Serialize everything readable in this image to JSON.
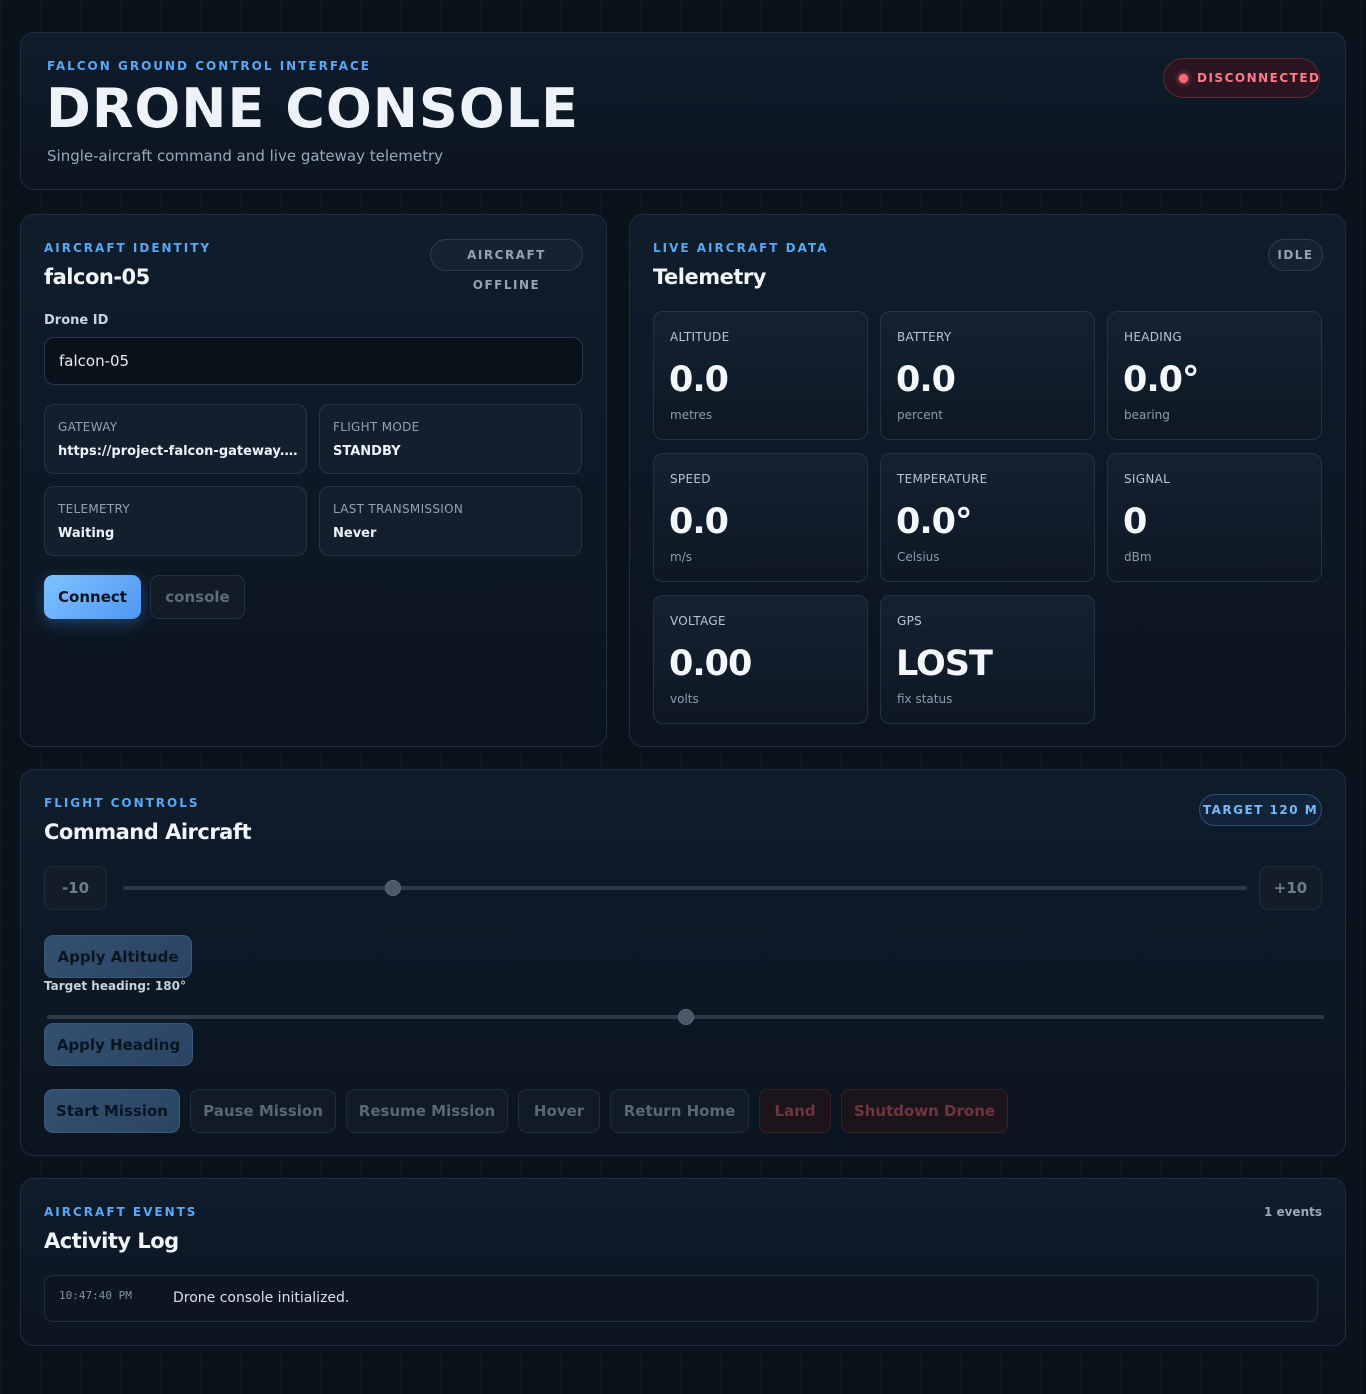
{
  "header": {
    "eyebrow": "FALCON GROUND CONTROL INTERFACE",
    "title": "DRONE CONSOLE",
    "subtitle": "Single-aircraft command and live gateway telemetry",
    "connection_status": "DISCONNECTED"
  },
  "identity": {
    "eyebrow": "AIRCRAFT IDENTITY",
    "title": "falcon-05",
    "status_pill": "AIRCRAFT OFFLINE",
    "drone_id_label": "Drone ID",
    "drone_id_value": "falcon-05",
    "info": [
      {
        "label": "GATEWAY",
        "value": "https://project-falcon-gateway.o..."
      },
      {
        "label": "FLIGHT MODE",
        "value": "STANDBY"
      },
      {
        "label": "TELEMETRY",
        "value": "Waiting"
      },
      {
        "label": "LAST TRANSMISSION",
        "value": "Never"
      }
    ],
    "connect_label": "Connect",
    "console_label": "console"
  },
  "telemetry": {
    "eyebrow": "LIVE AIRCRAFT DATA",
    "title": "Telemetry",
    "status_pill": "IDLE",
    "metrics": [
      {
        "label": "ALTITUDE",
        "value": "0.0",
        "unit": "metres"
      },
      {
        "label": "BATTERY",
        "value": "0.0",
        "unit": "percent"
      },
      {
        "label": "HEADING",
        "value": "0.0°",
        "unit": "bearing"
      },
      {
        "label": "SPEED",
        "value": "0.0",
        "unit": "m/s"
      },
      {
        "label": "TEMPERATURE",
        "value": "0.0°",
        "unit": "Celsius"
      },
      {
        "label": "SIGNAL",
        "value": "0",
        "unit": "dBm"
      },
      {
        "label": "VOLTAGE",
        "value": "0.00",
        "unit": "volts"
      },
      {
        "label": "GPS",
        "value": "LOST",
        "unit": "fix status"
      }
    ]
  },
  "controls": {
    "eyebrow": "FLIGHT CONTROLS",
    "title": "Command Aircraft",
    "target_pill": "TARGET 120 M",
    "altitude_decrement": "-10",
    "altitude_increment": "+10",
    "altitude_slider_fraction": 0.24,
    "apply_altitude": "Apply Altitude",
    "heading_label": "Target heading: 180°",
    "heading_slider_fraction": 0.5,
    "apply_heading": "Apply Heading",
    "actions": {
      "start": "Start Mission",
      "pause": "Pause Mission",
      "resume": "Resume Mission",
      "hover": "Hover",
      "return_home": "Return Home",
      "land": "Land",
      "shutdown": "Shutdown Drone"
    }
  },
  "log": {
    "eyebrow": "AIRCRAFT EVENTS",
    "title": "Activity Log",
    "count": "1 events",
    "entries": [
      {
        "time": "10:47:40 PM",
        "message": "Drone console initialized."
      }
    ]
  },
  "colors": {
    "accent": "#5aa8f5",
    "danger": "#ff7b8a",
    "background": "#0a121b"
  }
}
